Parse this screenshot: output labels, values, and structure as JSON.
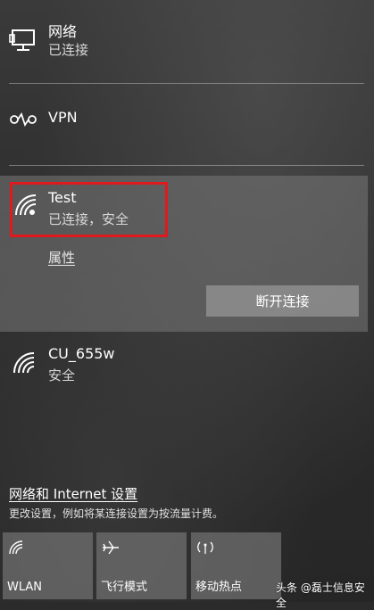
{
  "network": {
    "title": "网络",
    "status": "已连接"
  },
  "vpn": {
    "title": "VPN"
  },
  "selected_network": {
    "name": "Test",
    "status": "已连接，安全",
    "properties_label": "属性",
    "disconnect_label": "断开连接"
  },
  "other_network": {
    "name": "CU_655w",
    "status": "安全"
  },
  "settings": {
    "link_label": "网络和 Internet 设置",
    "description": "更改设置，例如将某连接设置为按流量计费。"
  },
  "quick_actions": [
    {
      "label": "WLAN",
      "icon": "wifi-icon"
    },
    {
      "label": "飞行模式",
      "icon": "airplane-icon"
    },
    {
      "label": "移动热点",
      "icon": "hotspot-icon"
    }
  ],
  "watermark": "头条 @磊士信息安全",
  "colors": {
    "highlight": "#e0191e"
  }
}
